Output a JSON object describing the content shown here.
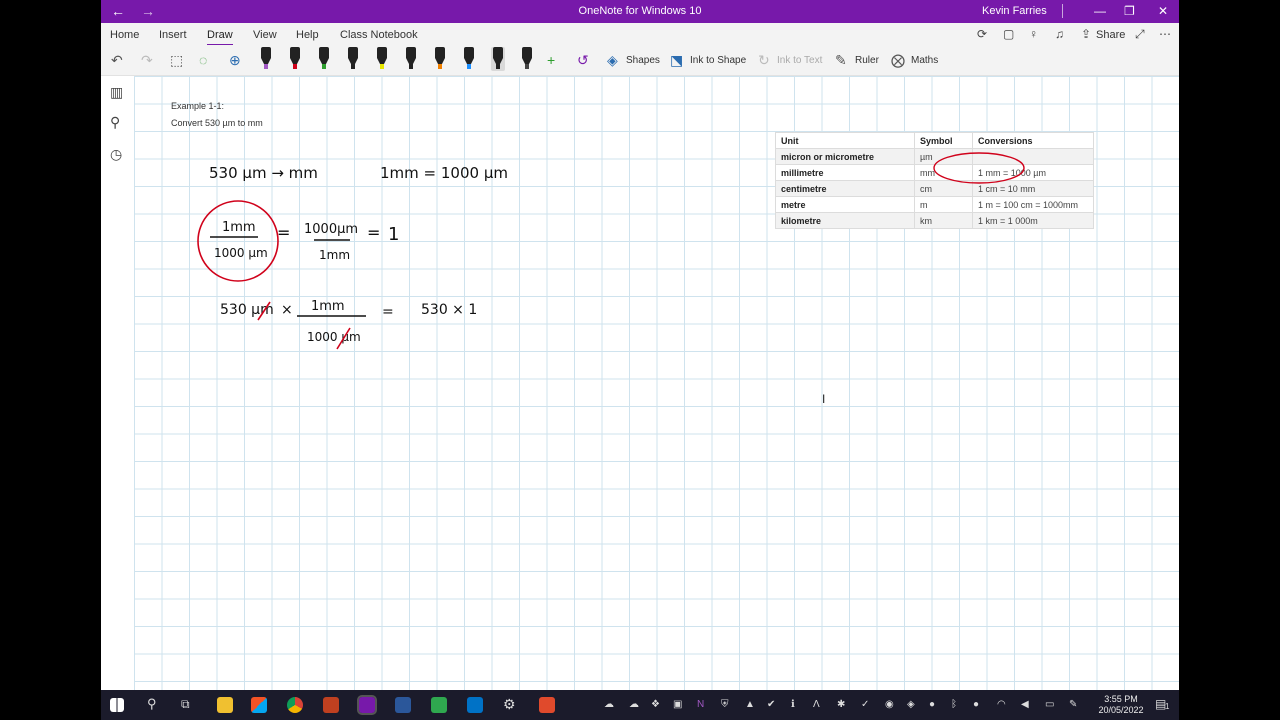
{
  "titlebar": {
    "back_glyph": "←",
    "forward_glyph": "→",
    "title": "OneNote for Windows 10",
    "user": "Kevin Farries",
    "minimize_glyph": "—",
    "maximize_glyph": "❐",
    "close_glyph": "✕"
  },
  "menu": {
    "tabs": [
      "Home",
      "Insert",
      "Draw",
      "View",
      "Help",
      "Class Notebook"
    ],
    "active_tab": "Draw",
    "share_label": "Share"
  },
  "toolbar": {
    "shapes_label": "Shapes",
    "ink_to_shape_label": "Ink to Shape",
    "ink_to_text_label": "Ink to Text",
    "ruler_label": "Ruler",
    "maths_label": "Maths",
    "pens": [
      {
        "name": "pen-black-purple",
        "color": "#a259c4"
      },
      {
        "name": "pen-red",
        "color": "#d0021b"
      },
      {
        "name": "pen-green",
        "color": "#2e9e2e"
      },
      {
        "name": "pen-black",
        "color": "#222222"
      },
      {
        "name": "highlighter-yellow",
        "color": "#e8e800"
      },
      {
        "name": "pen-black-2",
        "color": "#222222"
      },
      {
        "name": "pen-orange",
        "color": "#f08000"
      },
      {
        "name": "pen-blue",
        "color": "#1e90ff"
      },
      {
        "name": "pen-black-selected",
        "color": "#222222"
      },
      {
        "name": "highlighter-black",
        "color": "#444444"
      }
    ],
    "add_pen_glyph": "+"
  },
  "page": {
    "example_title": "Example 1-1:",
    "example_prompt": "Convert 530 µm to mm",
    "ink_color": "#111111",
    "highlight_color": "#d0021b",
    "ink_lines": {
      "line1_left": "530 µm → mm",
      "line1_right": "1mm = 1000 µm",
      "fraction1_num": "1mm",
      "fraction1_den": "1000 µm",
      "equals1": "=",
      "fraction2_num": "1000µm",
      "fraction2_den": "1mm",
      "equals2": "=",
      "one": "1",
      "line3_left": "530 µm",
      "times": "×",
      "fraction3_num": "1mm",
      "fraction3_den": "1000 µm",
      "equals3": "=",
      "line3_right": "530 × 1"
    }
  },
  "conversion_table": {
    "headers": [
      "Unit",
      "Symbol",
      "Conversions"
    ],
    "rows": [
      [
        "micron or micrometre",
        "µm",
        ""
      ],
      [
        "millimetre",
        "mm",
        "1 mm = 1000 µm"
      ],
      [
        "centimetre",
        "cm",
        "1 cm = 10 mm"
      ],
      [
        "metre",
        "m",
        "1 m = 100 cm = 1000mm"
      ],
      [
        "kilometre",
        "km",
        "1 km = 1 000m"
      ]
    ]
  },
  "taskbar": {
    "time": "3:55 PM",
    "date": "20/05/2022",
    "notification_count": "1"
  }
}
